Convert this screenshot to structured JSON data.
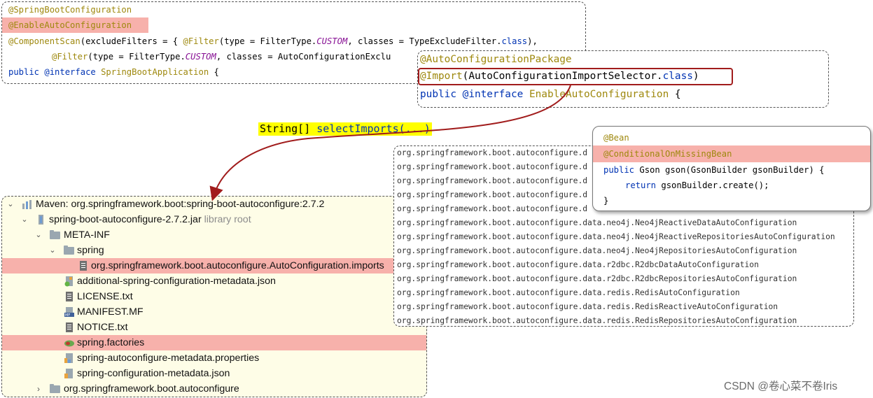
{
  "config_box": {
    "line1": "@SpringBootConfiguration",
    "line2": "@EnableAutoConfiguration",
    "line3_a": "@ComponentScan",
    "line3_b": "(excludeFilters = { ",
    "line3_c": "@Filter",
    "line3_d": "(type = FilterType.",
    "line3_e": "CUSTOM",
    "line3_f": ", classes = TypeExcludeFilter.",
    "line3_g": "class",
    "line3_h": "),",
    "line4_a": "@Filter",
    "line4_b": "(type = FilterType.",
    "line4_c": "CUSTOM",
    "line4_d": ", classes = AutoConfigurationExclu",
    "line5_a": "public ",
    "line5_b": "@interface ",
    "line5_c": "SpringBootApplication",
    "line5_d": " {"
  },
  "enable_box": {
    "line1": "@AutoConfigurationPackage",
    "line2_a": "@Import",
    "line2_b": "(AutoConfigurationImportSelector.",
    "line2_c": "class",
    "line2_d": ")",
    "line3_a": "public ",
    "line3_b": "@interface ",
    "line3_c": "EnableAutoConfiguration",
    "line3_d": " {"
  },
  "selector_label_a": "String[] ",
  "selector_label_b": "selectImports(...)",
  "import_list": [
    "org.springframework.boot.autoconfigure.d",
    "org.springframework.boot.autoconfigure.d",
    "org.springframework.boot.autoconfigure.d",
    "org.springframework.boot.autoconfigure.d",
    "org.springframework.boot.autoconfigure.d",
    "org.springframework.boot.autoconfigure.data.neo4j.Neo4jReactiveDataAutoConfiguration",
    "org.springframework.boot.autoconfigure.data.neo4j.Neo4jReactiveRepositoriesAutoConfiguration",
    "org.springframework.boot.autoconfigure.data.neo4j.Neo4jRepositoriesAutoConfiguration",
    "org.springframework.boot.autoconfigure.data.r2dbc.R2dbcDataAutoConfiguration",
    "org.springframework.boot.autoconfigure.data.r2dbc.R2dbcRepositoriesAutoConfiguration",
    "org.springframework.boot.autoconfigure.data.redis.RedisAutoConfiguration",
    "org.springframework.boot.autoconfigure.data.redis.RedisReactiveAutoConfiguration",
    "org.springframework.boot.autoconfigure.data.redis.RedisRepositoriesAutoConfiguration"
  ],
  "bean_card": {
    "line1": "@Bean",
    "line2": "@ConditionalOnMissingBean",
    "line3_a": "public ",
    "line3_b": "Gson gson(GsonBuilder gsonBuilder) {",
    "line4_a": "return ",
    "line4_b": "gsonBuilder.create();",
    "line5": "}"
  },
  "tree": {
    "root": "Maven: org.springframework.boot:spring-boot-autoconfigure:2.7.2",
    "jar": "spring-boot-autoconfigure-2.7.2.jar",
    "jar_hint": "library root",
    "meta_inf": "META-INF",
    "spring": "spring",
    "imports_file": "org.springframework.boot.autoconfigure.AutoConfiguration.imports",
    "additional_json": "additional-spring-configuration-metadata.json",
    "license": "LICENSE.txt",
    "manifest": "MANIFEST.MF",
    "notice": "NOTICE.txt",
    "factories": "spring.factories",
    "metadata_props": "spring-autoconfigure-metadata.properties",
    "metadata_json": "spring-configuration-metadata.json",
    "package": "org.springframework.boot.autoconfigure"
  },
  "watermark": "CSDN @卷心菜不卷Iris",
  "colors": {
    "highlight": "#f7b1ab",
    "annotation": "#9e880d",
    "keyword": "#0033b3",
    "constant": "#871094",
    "arrow": "#a11c1c",
    "label_bg": "#ffff00",
    "tree_bg": "#fefde7"
  }
}
